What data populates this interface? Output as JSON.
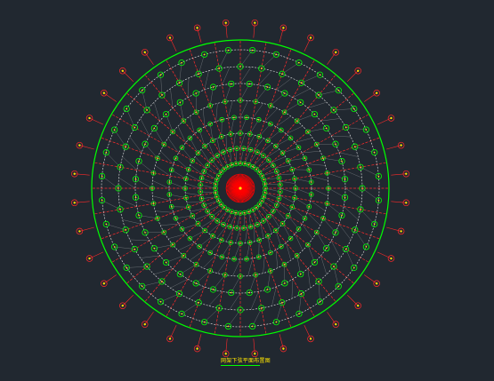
{
  "drawing": {
    "caption": "网架下弦平面布置图",
    "ring_radii": [
      28,
      45,
      62,
      80,
      99,
      118,
      137,
      156,
      167
    ],
    "radial_count": 36,
    "colors": {
      "background": "#212830",
      "outer_circle": "#00ff00",
      "ring_line": "#ffffff",
      "radial_line": "#ff2a2a",
      "node": "#00ff00",
      "label": "#ffe600",
      "center": "#ff0000"
    }
  }
}
